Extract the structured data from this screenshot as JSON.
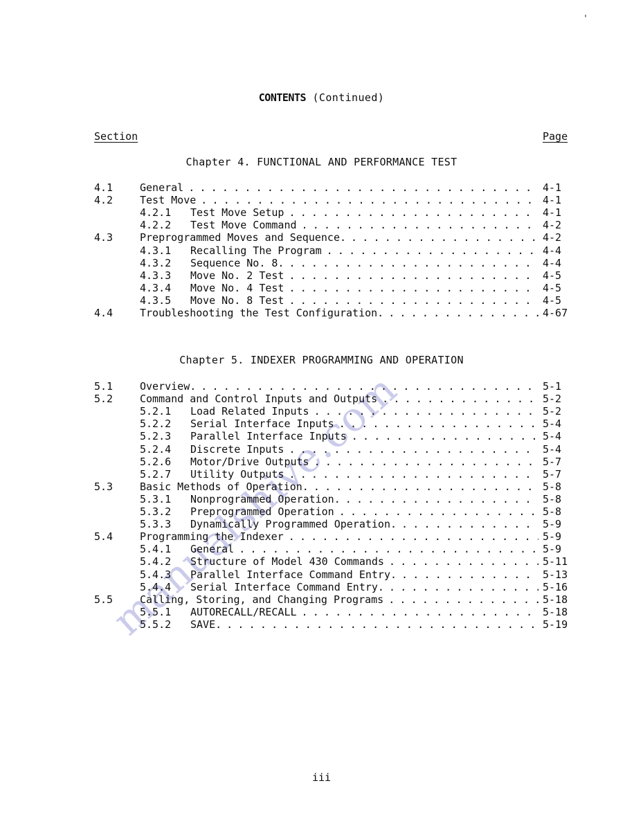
{
  "document": {
    "title_bold": "CONTENTS",
    "title_rest": "(Continued)",
    "folio": "iii",
    "watermark": "manualshive.com",
    "watermark_color": "#c7c7ea"
  },
  "columns": {
    "section_header": "Section",
    "page_header": "Page"
  },
  "chapters": [
    {
      "heading": "Chapter 4.   FUNCTIONAL AND PERFORMANCE TEST",
      "entries": [
        {
          "number": "4.1",
          "title": "General",
          "page": "4-1",
          "level": 1
        },
        {
          "number": "4.2",
          "title": "Test Move",
          "page": "4-1",
          "level": 1
        },
        {
          "number": "4.2.1",
          "title": "Test Move Setup",
          "page": "4-1",
          "level": 2
        },
        {
          "number": "4.2.2",
          "title": "Test Move Command",
          "page": "4-2",
          "level": 2
        },
        {
          "number": "4.3",
          "title": "Preprogrammed Moves and Sequence.",
          "page": "4-2",
          "level": 1
        },
        {
          "number": "4.3.1",
          "title": "Recalling The Program",
          "page": "4-4",
          "level": 2
        },
        {
          "number": "4.3.2",
          "title": "Sequence No. 8.",
          "page": "4-4",
          "level": 2
        },
        {
          "number": "4.3.3",
          "title": "Move No. 2 Test",
          "page": "4-5",
          "level": 2
        },
        {
          "number": "4.3.4",
          "title": "Move No. 4 Test",
          "page": "4-5",
          "level": 2
        },
        {
          "number": "4.3.5",
          "title": "Move No. 8 Test",
          "page": "4-5",
          "level": 2
        },
        {
          "number": "4.4",
          "title": "Troubleshooting the Test Configuration.",
          "page": "4-67",
          "level": 1
        }
      ]
    },
    {
      "heading": "Chapter 5.   INDEXER PROGRAMMING AND OPERATION",
      "entries": [
        {
          "number": "5.1",
          "title": "Overview.",
          "page": "5-1",
          "level": 1
        },
        {
          "number": "5.2",
          "title": "Command and Control Inputs and Outputs",
          "page": "5-2",
          "level": 1
        },
        {
          "number": "5.2.1",
          "title": "Load Related Inputs",
          "page": "5-2",
          "level": 2
        },
        {
          "number": "5.2.2",
          "title": "Serial Interface Inputs",
          "page": "5-4",
          "level": 2
        },
        {
          "number": "5.2.3",
          "title": "Parallel Interface Inputs",
          "page": "5-4",
          "level": 2
        },
        {
          "number": "5.2.4",
          "title": "Discrete Inputs",
          "page": "5-4",
          "level": 2
        },
        {
          "number": "5.2.6",
          "title": "Motor/Drive Outputs",
          "page": "5-7",
          "level": 2
        },
        {
          "number": "5.2.7",
          "title": "Utility Outputs",
          "page": "5-7",
          "level": 2
        },
        {
          "number": "5.3",
          "title": "Basic Methods of Operation.",
          "page": "5-8",
          "level": 1
        },
        {
          "number": "5.3.1",
          "title": "Nonprogrammed Operation.",
          "page": "5-8",
          "level": 2
        },
        {
          "number": "5.3.2",
          "title": "Preprogrammed Operation",
          "page": "5-8",
          "level": 2
        },
        {
          "number": "5.3.3",
          "title": "Dynamically Programmed Operation.",
          "page": "5-9",
          "level": 2
        },
        {
          "number": "5.4",
          "title": "Programming the Indexer",
          "page": "5-9",
          "level": 1
        },
        {
          "number": "5.4.1",
          "title": "General",
          "page": "5-9",
          "level": 2
        },
        {
          "number": "5.4.2",
          "title": "Structure of Model 430 Commands",
          "page": "5-11",
          "level": 2
        },
        {
          "number": "5.4.3",
          "title": "Parallel Interface Command Entry.",
          "page": "5-13",
          "level": 2
        },
        {
          "number": "5.4.4",
          "title": "Serial Interface Command Entry.",
          "page": "5-16",
          "level": 2
        },
        {
          "number": "5.5",
          "title": "Calling, Storing, and Changing Programs",
          "page": "5-18",
          "level": 1
        },
        {
          "number": "5.5.1",
          "title": "AUTORECALL/RECALL",
          "page": "5-18",
          "level": 2
        },
        {
          "number": "5.5.2",
          "title": "SAVE.",
          "page": "5-19",
          "level": 2
        }
      ]
    }
  ]
}
